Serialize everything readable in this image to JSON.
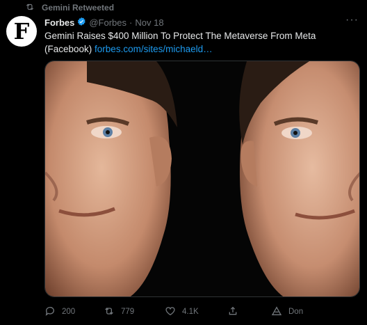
{
  "retweet": {
    "text": "Gemini Retweeted"
  },
  "tweet": {
    "avatar_letter": "F",
    "author": "Forbes",
    "handle": "@Forbes",
    "separator": "·",
    "date": "Nov 18",
    "text": "Gemini Raises $400 Million To Protect The Metaverse From Meta (Facebook)",
    "link": "forbes.com/sites/michaeld…",
    "more": "···"
  },
  "actions": {
    "replies": "200",
    "retweets": "779",
    "likes": "4.1K",
    "extra": "Don"
  },
  "colors": {
    "background": "#000000",
    "text": "#e7e9ea",
    "muted": "#71767b",
    "link": "#1d9bf0",
    "verified": "#1d9bf0"
  },
  "icons": [
    "retweet-icon",
    "verified-icon",
    "more-icon",
    "reply-icon",
    "like-icon",
    "share-icon",
    "translate-icon"
  ]
}
